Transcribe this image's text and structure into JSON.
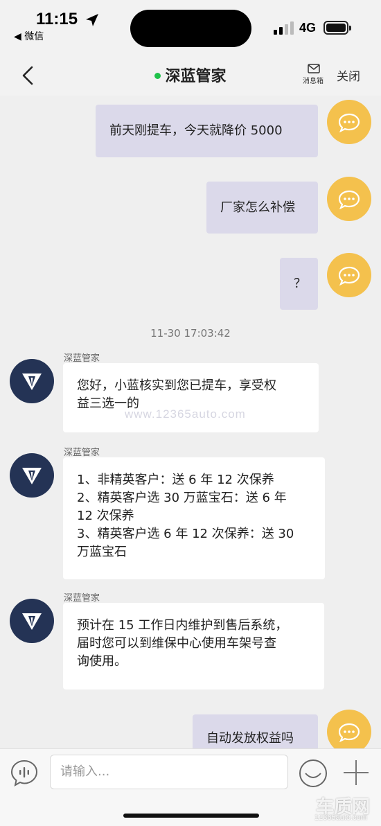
{
  "status_bar": {
    "time": "11:15",
    "back_app": "◀ 微信",
    "network": "4G"
  },
  "header": {
    "title": "深蓝管家",
    "inbox_label": "消息箱",
    "close_label": "关闭",
    "online_color": "#1fc24a"
  },
  "messages": [
    {
      "from": "user",
      "text": "前天刚提车，今天就降价 5000"
    },
    {
      "from": "user",
      "text": "厂家怎么补偿"
    },
    {
      "from": "user",
      "text": "？"
    },
    {
      "timestamp": "11-30 17:03:42"
    },
    {
      "from": "bot",
      "sender": "深蓝管家",
      "lines": [
        "您好，小蓝核实到您已提车，享受权",
        "益三选一的"
      ]
    },
    {
      "from": "bot",
      "sender": "深蓝管家",
      "lines": [
        "1、非精英客户：送 6 年 12 次保养",
        "2、精英客户选 30 万蓝宝石：送 6 年",
        "12 次保养",
        "3、精英客户选 6 年 12 次保养：送 30",
        "万蓝宝石"
      ]
    },
    {
      "from": "bot",
      "sender": "深蓝管家",
      "lines": [
        "预计在 15 工作日内维护到售后系统，",
        "届时您可以到维保中心使用车架号查",
        "询使用。"
      ]
    },
    {
      "from": "user",
      "text": "自动发放权益吗"
    }
  ],
  "input": {
    "placeholder": "请输入..."
  },
  "watermark": {
    "inline_url": "www.12365auto.com",
    "logo_text": "车质网",
    "logo_url": "12365auto.com"
  },
  "colors": {
    "user_bubble": "#dbd9ea",
    "bot_bubble": "#ffffff",
    "user_avatar": "#f4c14d",
    "bot_avatar": "#243355"
  }
}
